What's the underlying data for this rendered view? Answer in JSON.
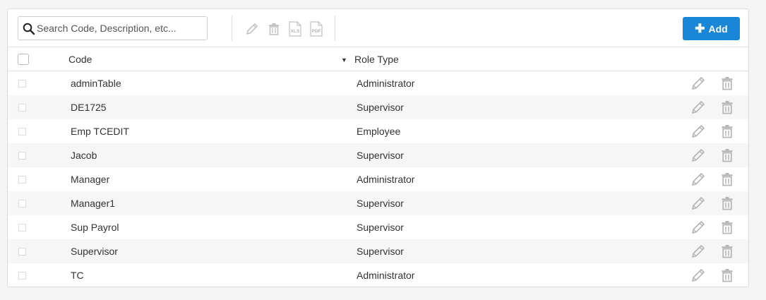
{
  "search": {
    "placeholder": "Search Code, Description, etc...",
    "value": ""
  },
  "toolbar": {
    "icons": [
      "pencil-icon",
      "trash-icon",
      "xls-export-icon",
      "pdf-export-icon"
    ],
    "xls_label": "XLS",
    "pdf_label": "PDF",
    "add_label": "Add"
  },
  "table": {
    "columns": {
      "code": "Code",
      "role_type": "Role Type"
    },
    "sort": {
      "column": "role_type",
      "direction": "desc"
    },
    "rows": [
      {
        "code": "adminTable",
        "role": "Administrator"
      },
      {
        "code": "DE1725",
        "role": "Supervisor"
      },
      {
        "code": "Emp TCEDIT",
        "role": "Employee"
      },
      {
        "code": "Jacob",
        "role": "Supervisor"
      },
      {
        "code": "Manager",
        "role": "Administrator"
      },
      {
        "code": "Manager1",
        "role": "Supervisor"
      },
      {
        "code": "Sup Payrol",
        "role": "Supervisor"
      },
      {
        "code": "Supervisor",
        "role": "Supervisor"
      },
      {
        "code": "TC",
        "role": "Administrator"
      }
    ]
  },
  "colors": {
    "accent": "#1a86d8",
    "icon_gray": "#b5b5b5",
    "row_alt": "#f6f6f6",
    "border": "#dcdcdc"
  }
}
